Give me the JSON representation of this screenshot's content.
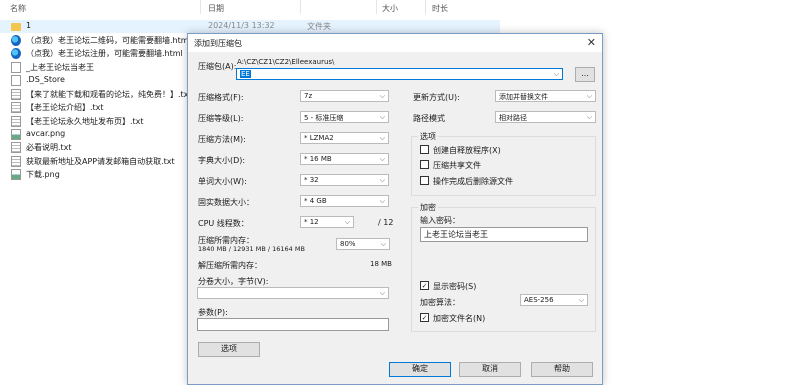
{
  "explorer": {
    "columns": {
      "name": "名称",
      "date": "日期",
      "size": "大小",
      "tags": "时长"
    },
    "rows": [
      {
        "name": "1",
        "date": "2024/11/3 13:32",
        "type": "文件夹",
        "icon": "folder"
      },
      {
        "name": "（点我）老王论坛二维码，可能需要翻墙.html",
        "icon": "edge"
      },
      {
        "name": "（点我）老王论坛注册，可能需要翻墙.html",
        "icon": "edge"
      },
      {
        "name": "_上老王论坛当老王",
        "icon": "file"
      },
      {
        "name": ".DS_Store",
        "icon": "file"
      },
      {
        "name": "【来了就能下载和观看的论坛，纯免费！】.txt",
        "icon": "txt"
      },
      {
        "name": "【老王论坛介绍】.txt",
        "icon": "txt"
      },
      {
        "name": "【老王论坛永久地址发布页】.txt",
        "icon": "txt"
      },
      {
        "name": "avcar.png",
        "icon": "png"
      },
      {
        "name": "必看说明.txt",
        "icon": "txt"
      },
      {
        "name": "获取最新地址及APP请发邮箱自动获取.txt",
        "icon": "txt"
      },
      {
        "name": "下载.png",
        "icon": "png"
      }
    ]
  },
  "dialog": {
    "title": "添加到压缩包",
    "archive_label": "压缩包(A):",
    "archive_path": "A:\\CZ\\CZ1\\CZ2\\Elleexaurus\\",
    "archive_value": "EE",
    "browse": "...",
    "format_label": "压缩格式(F):",
    "format_value": "7z",
    "level_label": "压缩等级(L):",
    "level_value": "5 - 标准压缩",
    "method_label": "压缩方法(M):",
    "method_value": "* LZMA2",
    "dict_label": "字典大小(D):",
    "dict_value": "* 16 MB",
    "word_label": "单词大小(W):",
    "word_value": "* 32",
    "solid_label": "固实数据大小：",
    "solid_value": "* 4 GB",
    "threads_label": "CPU 线程数：",
    "threads_value": "* 12",
    "threads_total": "/ 12",
    "mem_label": "压缩所需内存：",
    "mem_value": "1840 MB / 12931 MB / 16164 MB",
    "mem_pct": "80%",
    "decomp_label": "解压缩所需内存：",
    "decomp_value": "18 MB",
    "split_label": "分卷大小，字节(V):",
    "params_label": "参数(P):",
    "options_btn": "选项",
    "update_label": "更新方式(U):",
    "update_value": "添加并替换文件",
    "path_label": "路径模式",
    "path_value": "相对路径",
    "options_group": "选项",
    "opt_sfx": "创建自释放程序(X)",
    "opt_shared": "压缩共享文件",
    "opt_delete": "操作完成后删除源文件",
    "encrypt_group": "加密",
    "password_label": "输入密码：",
    "password_value": "上老王论坛当老王",
    "show_password": "显示密码(S)",
    "enc_method_label": "加密算法：",
    "enc_method_value": "AES-256",
    "enc_names": "加密文件名(N)",
    "ok": "确定",
    "cancel": "取消",
    "help": "帮助"
  }
}
